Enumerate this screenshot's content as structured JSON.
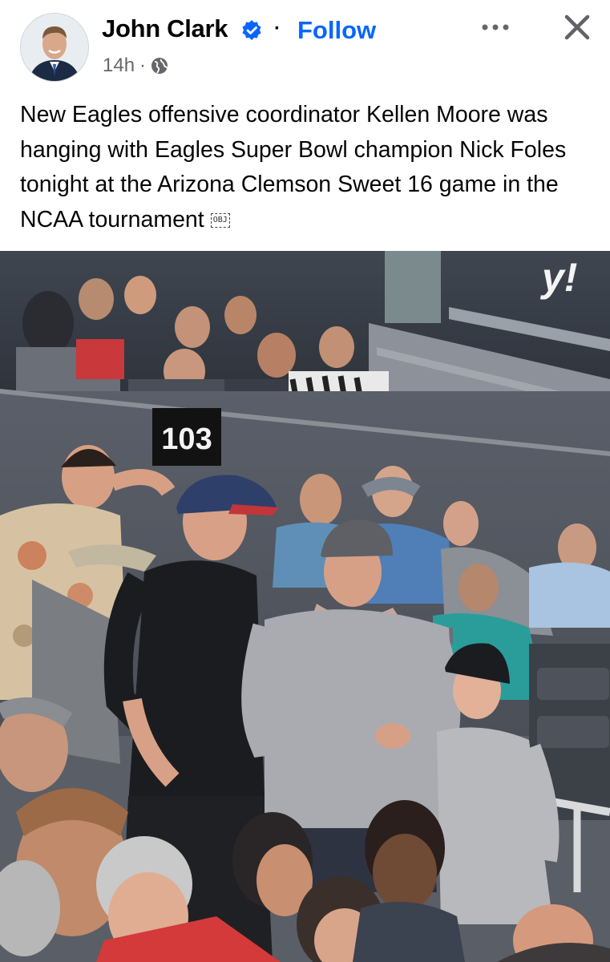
{
  "post": {
    "author_name": "John Clark",
    "follow_label": "Follow",
    "separator": "·",
    "timestamp": "14h",
    "meta_dot": "·",
    "text": "New Eagles offensive coordinator Kellen Moore was hanging with Eagles Super Bowl champion Nick Foles tonight at the Arizona Clemson Sweet 16 game in the NCAA tournament",
    "obj_glyph": "OBJ"
  },
  "photo": {
    "section_sign": "103",
    "watermark": "y!"
  },
  "icons": {
    "verified": "verified-badge-icon",
    "more": "more-horizontal-icon",
    "close": "close-icon",
    "privacy": "globe-icon"
  },
  "colors": {
    "follow_blue": "#0866ff",
    "verified_blue": "#0866ff",
    "meta_gray": "#65676b"
  }
}
